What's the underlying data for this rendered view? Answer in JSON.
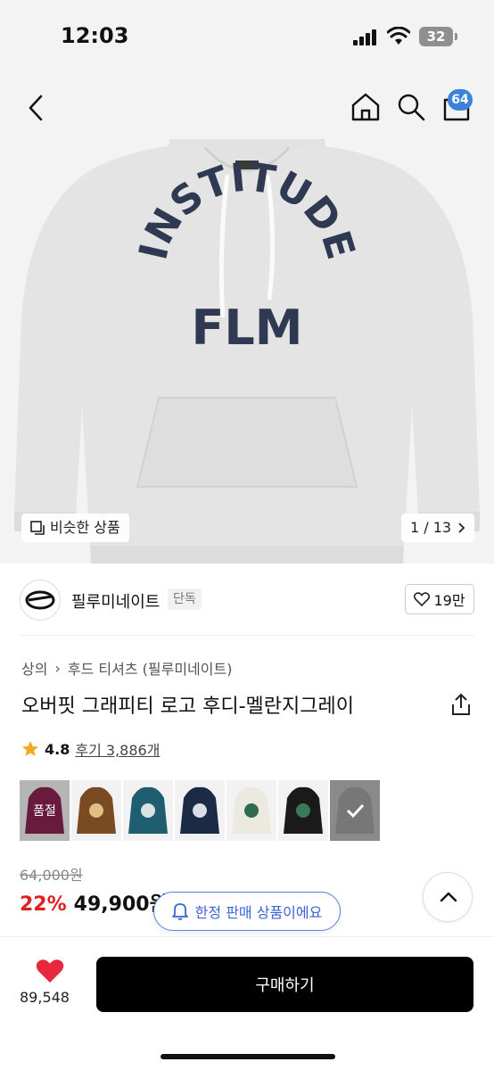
{
  "status_bar": {
    "time": "12:03",
    "battery": "32"
  },
  "nav": {
    "cart_count": "64"
  },
  "hero": {
    "print_text_top": "INSTITUDE",
    "print_text_bottom": "FLM",
    "similar_label": "비슷한 상품",
    "page_indicator": "1 / 13"
  },
  "brand": {
    "name": "필루미네이트",
    "tag": "단독",
    "likes": "19만"
  },
  "product": {
    "breadcrumb": [
      "상의",
      "후드 티셔츠 (필루미네이트)"
    ],
    "title": "오버핏 그래피티 로고 후디-멜란지그레이",
    "rating": "4.8",
    "review_label": "후기 3,886개"
  },
  "swatches": [
    {
      "color": "#8b2550",
      "sold_out": "품절"
    },
    {
      "color": "#7a4a22"
    },
    {
      "color": "#1f5e70"
    },
    {
      "color": "#1b2b45"
    },
    {
      "color": "#ece9e0"
    },
    {
      "color": "#1a1a1a"
    },
    {
      "color": "#777777"
    }
  ],
  "price": {
    "original": "64,000원",
    "discount": "22%",
    "sale": "49,900원"
  },
  "toast": {
    "label": "한정 판매 상품이에요"
  },
  "bottom": {
    "wish_count": "89,548",
    "buy_label": "구매하기"
  },
  "colors": {
    "accent": "#3b62d8",
    "sale": "#e02020",
    "heart": "#e8283c",
    "print": "#2f3a52"
  }
}
